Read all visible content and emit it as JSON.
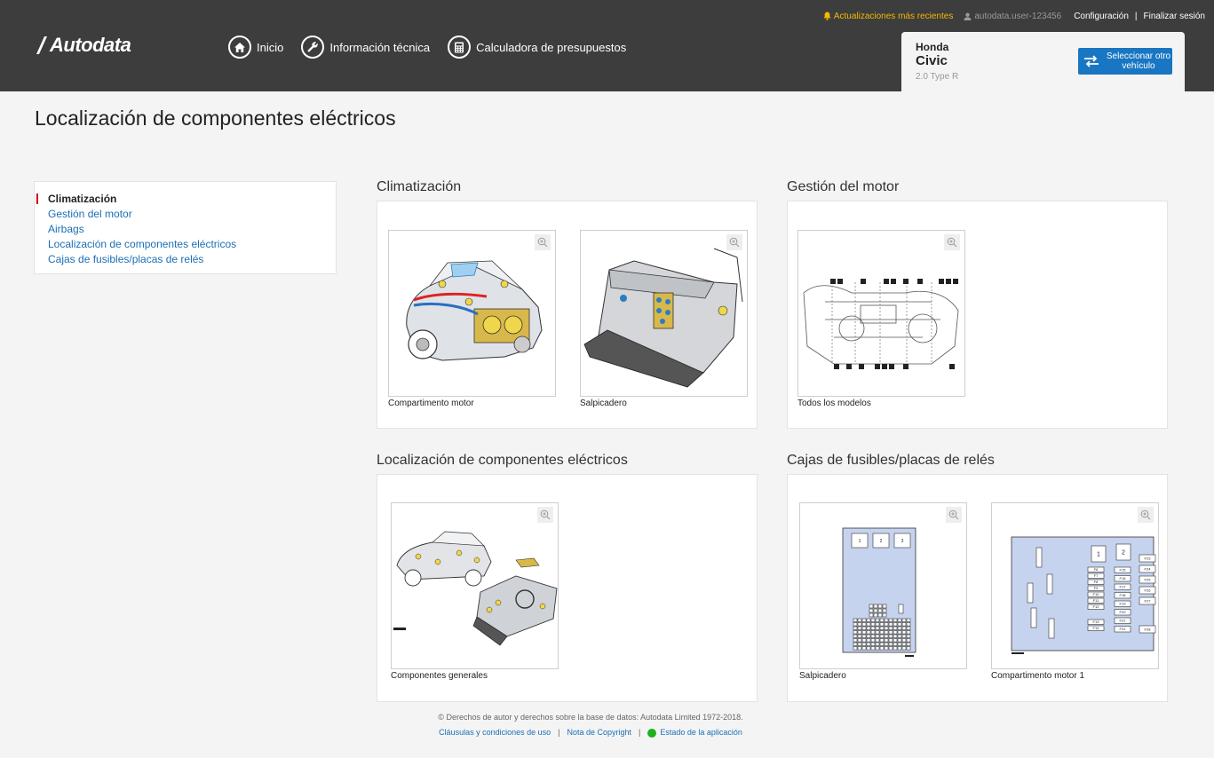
{
  "header": {
    "notification": "Actualizaciones más recientes",
    "user": "autodata.user-123456",
    "config_link": "Configuración",
    "logout_link": "Finalizar sesión",
    "logo_text": "Autodata",
    "nav": [
      {
        "label": "Inicio",
        "icon": "home-icon"
      },
      {
        "label": "Información técnica",
        "icon": "wrench-icon"
      },
      {
        "label": "Calculadora de presupuestos",
        "icon": "calculator-icon"
      }
    ]
  },
  "vehicle": {
    "make": "Honda",
    "model": "Civic",
    "engine": "2.0 Type R",
    "change_button": "Seleccionar otro vehículo"
  },
  "page": {
    "title": "Localización de componentes eléctricos"
  },
  "sidebar": {
    "items": [
      {
        "label": "Climatización",
        "active": true
      },
      {
        "label": "Gestión del motor",
        "active": false
      },
      {
        "label": "Airbags",
        "active": false
      },
      {
        "label": "Localización de componentes eléctricos",
        "active": false
      },
      {
        "label": "Cajas de fusibles/placas de relés",
        "active": false
      }
    ]
  },
  "sections": [
    {
      "title": "Climatización",
      "thumbs": [
        {
          "caption": "Compartimento motor"
        },
        {
          "caption": "Salpicadero"
        }
      ]
    },
    {
      "title": "Gestión del motor",
      "thumbs": [
        {
          "caption": "Todos los modelos"
        }
      ]
    },
    {
      "title": "Localización de componentes eléctricos",
      "thumbs": [
        {
          "caption": "Componentes generales"
        }
      ]
    },
    {
      "title": "Cajas de fusibles/placas de relés",
      "thumbs": [
        {
          "caption": "Salpicadero"
        },
        {
          "caption": "Compartimento motor 1"
        }
      ]
    }
  ],
  "fusebox": {
    "dash_top": [
      "1",
      "2",
      "3"
    ],
    "engine_top": [
      "1",
      "2"
    ],
    "engine_left": [
      "F1",
      "F2",
      "F3",
      "F4",
      "F5"
    ],
    "engine_mid": [
      "F6",
      "F7",
      "F8",
      "F9",
      "F10",
      "F11",
      "F12",
      "F13",
      "F14"
    ],
    "engine_right1": [
      "F15",
      "F16",
      "F17",
      "F18",
      "F19",
      "F20",
      "F21",
      "F22"
    ],
    "engine_right2": [
      "F23",
      "F24",
      "F25",
      "F26",
      "F27",
      "F28"
    ]
  },
  "footer": {
    "copyright": "© Derechos de autor y derechos sobre la base de datos: Autodata Limited 1972-2018.",
    "terms": "Cláusulas y condiciones de uso",
    "copyright_note": "Nota de Copyright",
    "status": "Estado de la aplicación"
  },
  "colors": {
    "header_bg": "#3d3d3d",
    "accent_blue": "#1976c2",
    "link_blue": "#1a6fb5",
    "active_marker": "#d0021b",
    "alert_yellow": "#f5b800",
    "status_green": "#1db21d",
    "fusebox_fill": "#c6d3ee"
  }
}
